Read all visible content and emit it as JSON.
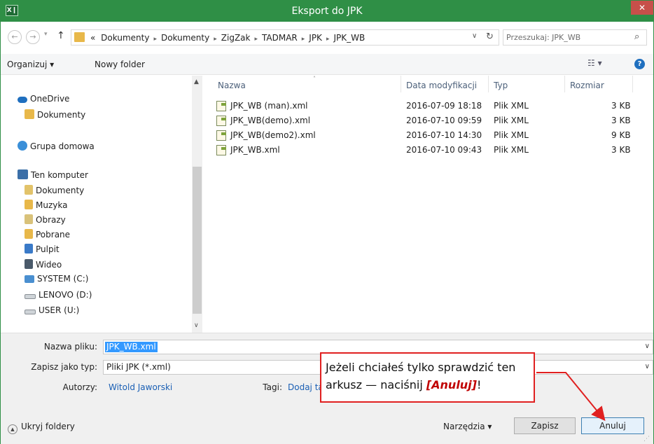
{
  "window": {
    "title": "Eksport do JPK",
    "app_icon": "X❙",
    "close_glyph": "✕"
  },
  "nav": {
    "back_glyph": "←",
    "forward_glyph": "→",
    "dropdown_glyph": "▾",
    "up_glyph": "↑",
    "breadcrumb_prefix": "«",
    "breadcrumb": [
      "Dokumenty",
      "Dokumenty",
      "ZigZak",
      "TADMAR",
      "JPK",
      "JPK_WB"
    ],
    "breadcrumb_sep": "▸",
    "address_dropdown": "∨",
    "refresh_glyph": "↻",
    "search_placeholder": "Przeszukaj: JPK_WB",
    "search_glyph": "⌕"
  },
  "toolbar": {
    "organize_label": "Organizuj ▾",
    "new_folder_label": "Nowy folder",
    "view_label": "☷ ▾",
    "help_label": "?"
  },
  "navpane": {
    "items": [
      {
        "label": "OneDrive",
        "icon": "onedrive-icon"
      },
      {
        "label": "Dokumenty",
        "icon": "folder-icon"
      },
      {
        "label": "Grupa domowa",
        "icon": "homegroup-icon"
      },
      {
        "label": "Ten komputer",
        "icon": "computer-icon"
      },
      {
        "label": "Dokumenty",
        "icon": "documents-icon"
      },
      {
        "label": "Muzyka",
        "icon": "music-icon"
      },
      {
        "label": "Obrazy",
        "icon": "pictures-icon"
      },
      {
        "label": "Pobrane",
        "icon": "downloads-icon"
      },
      {
        "label": "Pulpit",
        "icon": "desktop-icon"
      },
      {
        "label": "Wideo",
        "icon": "video-icon"
      },
      {
        "label": "SYSTEM (C:)",
        "icon": "system-drive-icon"
      },
      {
        "label": "LENOVO (D:)",
        "icon": "drive-icon"
      },
      {
        "label": "USER (U:)",
        "icon": "drive-icon"
      }
    ],
    "scroll_up": "▲",
    "scroll_down": "∨"
  },
  "filelist": {
    "columns": [
      "Nazwa",
      "Data modyfikacji",
      "Typ",
      "Rozmiar"
    ],
    "sort_glyph": "˄",
    "rows": [
      {
        "name": "JPK_WB (man).xml",
        "date": "2016-07-09 18:18",
        "type": "Plik XML",
        "size": "3 KB"
      },
      {
        "name": "JPK_WB(demo).xml",
        "date": "2016-07-10 09:59",
        "type": "Plik XML",
        "size": "3 KB"
      },
      {
        "name": "JPK_WB(demo2).xml",
        "date": "2016-07-10 14:30",
        "type": "Plik XML",
        "size": "9 KB"
      },
      {
        "name": "JPK_WB.xml",
        "date": "2016-07-10 09:43",
        "type": "Plik XML",
        "size": "3 KB"
      }
    ]
  },
  "form": {
    "filename_label": "Nazwa pliku:",
    "filename_value": "JPK_WB.xml",
    "savetype_label": "Zapisz jako typ:",
    "savetype_value": "Pliki JPK (*.xml)",
    "authors_label": "Autorzy:",
    "authors_value": "Witold Jaworski",
    "tags_label": "Tagi:",
    "tags_value": "Dodaj ta",
    "dropdown_glyph": "∨"
  },
  "footer": {
    "hide_folders_label": "Ukryj foldery",
    "hide_folders_glyph": "▲",
    "tools_label": "Narzędzia  ▾",
    "save_label": "Zapisz",
    "cancel_label": "Anuluj",
    "grip_glyph": "⋰"
  },
  "callout": {
    "line1": "Jeżeli chciałeś tylko sprawdzić ten",
    "line2_pre": "arkusz — naciśnij ",
    "line2_bold": "[Anuluj]",
    "line2_post": "!",
    "color": "#e02020"
  }
}
